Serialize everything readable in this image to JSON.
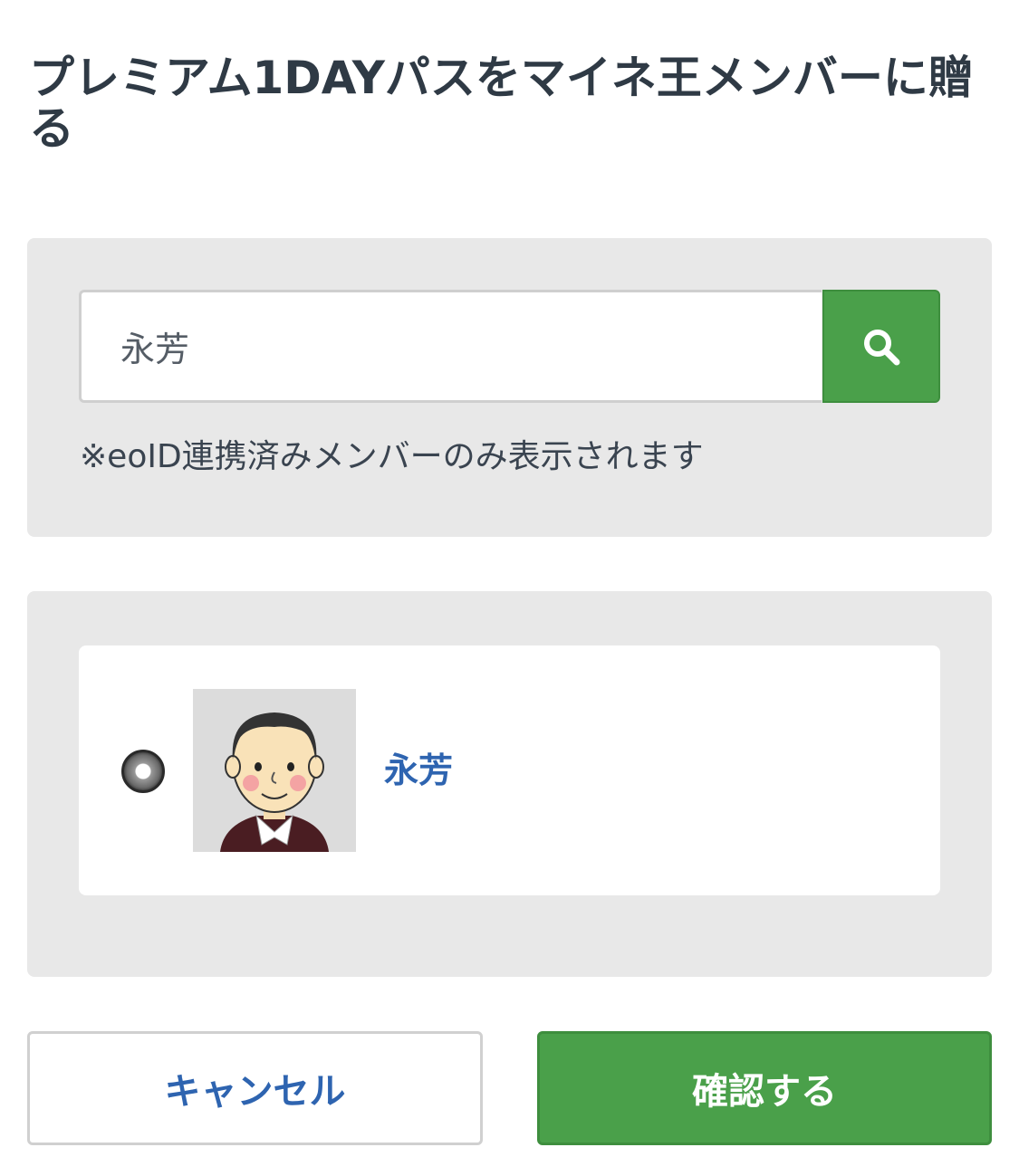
{
  "page": {
    "title": "プレミアム1DAYパスをマイネ王メンバーに贈る"
  },
  "search": {
    "value": "永芳",
    "placeholder": "",
    "note": "※eoID連携済みメンバーのみ表示されます",
    "button_icon": "search-icon"
  },
  "results": {
    "members": [
      {
        "name": "永芳",
        "selected": true,
        "avatar_icon": "avatar-image"
      }
    ]
  },
  "actions": {
    "cancel_label": "キャンセル",
    "confirm_label": "確認する"
  },
  "colors": {
    "accent_green": "#4aa04a",
    "link_blue": "#2e64b0",
    "panel_gray": "#e8e8e8",
    "text_dark": "#2f3a45"
  }
}
